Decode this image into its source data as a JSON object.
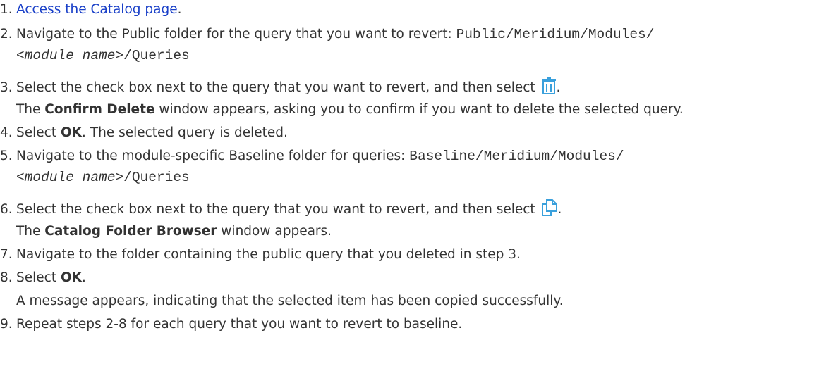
{
  "steps": [
    {
      "num": "1.",
      "link_text": "Access the Catalog page",
      "trail": "."
    },
    {
      "num": "2.",
      "text": "Navigate to the Public folder for the query that you want to revert: ",
      "path_a": "Public/Meridium/Modules/",
      "path_b": "<module name>",
      "path_c": "/Queries"
    },
    {
      "num": "3.",
      "text": "Select the check box next to the query that you want to revert, and then select ",
      "icon": "trash-icon",
      "trail": ".",
      "result_pre": "The ",
      "result_bold": "Confirm Delete",
      "result_post": " window appears, asking you to confirm if you want to delete the selected query."
    },
    {
      "num": "4.",
      "pre": "Select ",
      "bold": "OK",
      "post": ". The selected query is deleted."
    },
    {
      "num": "5.",
      "text": "Navigate to the module-specific Baseline folder for queries: ",
      "path_a": "Baseline/Meridium/Modules/",
      "path_b": "<module name>",
      "path_c": "/Queries"
    },
    {
      "num": "6.",
      "text": "Select the check box next to the query that you want to revert, and then select ",
      "icon": "copy-icon",
      "trail": ".",
      "result_pre": "The ",
      "result_bold": "Catalog Folder Browser",
      "result_post": " window appears."
    },
    {
      "num": "7.",
      "text": "Navigate to the folder containing the public query that you deleted in step 3."
    },
    {
      "num": "8.",
      "pre": "Select ",
      "bold": "OK",
      "post": ".",
      "result": "A message appears, indicating that the selected item has been copied successfully."
    },
    {
      "num": "9.",
      "text": "Repeat steps 2-8 for each query that you want to revert to baseline."
    }
  ],
  "colors": {
    "text": "#333333",
    "link": "#1a40c8",
    "icon": "#3aa0dc"
  }
}
